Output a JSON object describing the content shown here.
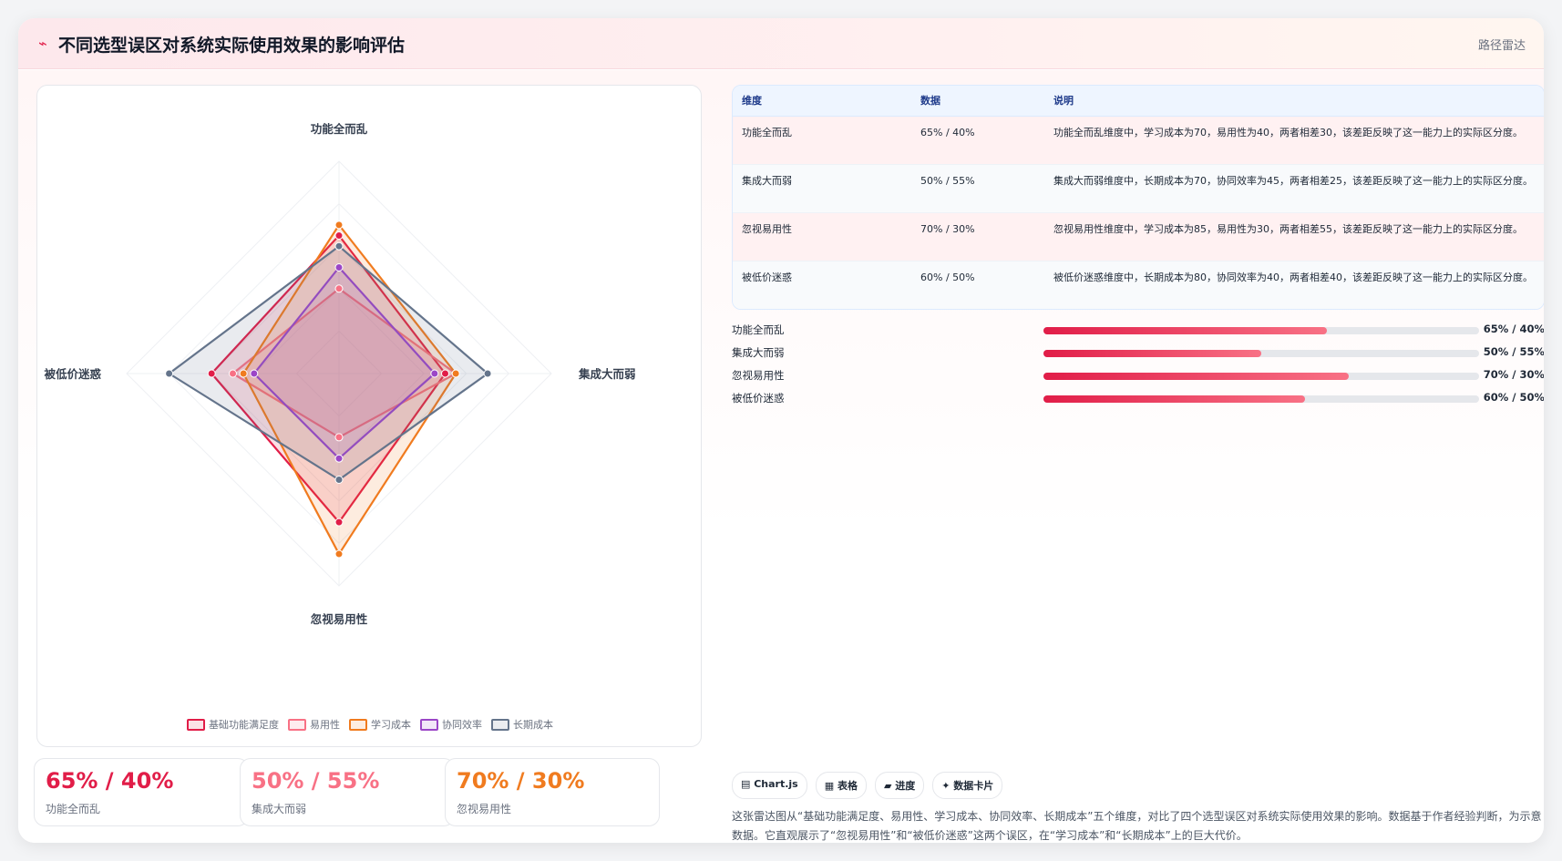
{
  "header": {
    "icon": "sparkline-icon",
    "title": "不同选型误区对系统实际使用效果的影响评估",
    "link": "路径雷达"
  },
  "chart_data": {
    "type": "radar",
    "axes": [
      "功能全而乱",
      "集成大而弱",
      "忽视易用性",
      "被低价迷惑"
    ],
    "range": [
      0,
      100
    ],
    "series": [
      {
        "name": "基础功能满足度",
        "color": "#e11d48",
        "values": [
          65,
          50,
          70,
          60
        ]
      },
      {
        "name": "易用性",
        "color": "#f87185",
        "values": [
          40,
          55,
          30,
          50
        ]
      },
      {
        "name": "学习成本",
        "color": "#f07b1f",
        "values": [
          70,
          55,
          85,
          45
        ]
      },
      {
        "name": "协同效率",
        "color": "#9b46c7",
        "values": [
          50,
          45,
          40,
          40
        ]
      },
      {
        "name": "长期成本",
        "color": "#64748b",
        "values": [
          60,
          70,
          50,
          80
        ]
      }
    ],
    "grid": true,
    "legend": "bottom"
  },
  "stats": [
    {
      "value": "65% / 40%",
      "label": "功能全而乱",
      "color": "#e11d48"
    },
    {
      "value": "50% / 55%",
      "label": "集成大而弱",
      "color": "#f87185"
    },
    {
      "value": "70% / 30%",
      "label": "忽视易用性",
      "color": "#f07b1f"
    }
  ],
  "table": {
    "headers": [
      "维度",
      "数据",
      "说明"
    ],
    "rows": [
      {
        "dim": "功能全而乱",
        "data": "65% / 40%",
        "note": "功能全而乱维度中，学习成本为70，易用性为40，两者相差30，该差距反映了这一能力上的实际区分度。"
      },
      {
        "dim": "集成大而弱",
        "data": "50% / 55%",
        "note": "集成大而弱维度中，长期成本为70，协同效率为45，两者相差25，该差距反映了这一能力上的实际区分度。"
      },
      {
        "dim": "忽视易用性",
        "data": "70% / 30%",
        "note": "忽视易用性维度中，学习成本为85，易用性为30，两者相差55，该差距反映了这一能力上的实际区分度。"
      },
      {
        "dim": "被低价迷惑",
        "data": "60% / 50%",
        "note": "被低价迷惑维度中，长期成本为80，协同效率为40，两者相差40，该差距反映了这一能力上的实际区分度。"
      }
    ]
  },
  "progress": [
    {
      "label": "功能全而乱",
      "value": "65% / 40%",
      "fill": 0.65
    },
    {
      "label": "集成大而弱",
      "value": "50% / 55%",
      "fill": 0.5
    },
    {
      "label": "忽视易用性",
      "value": "70% / 30%",
      "fill": 0.7
    },
    {
      "label": "被低价迷惑",
      "value": "60% / 50%",
      "fill": 0.6
    }
  ],
  "chips": [
    "▤ Chart.js",
    "▦ 表格",
    "▰ 进度",
    "✦ 数据卡片"
  ],
  "description": "这张雷达图从“基础功能满足度、易用性、学习成本、协同效率、长期成本”五个维度，对比了四个选型误区对系统实际使用效果的影响。数据基于作者经验判断，为示意数据。它直观展示了“忽视易用性”和“被低价迷惑”这两个误区，在“学习成本”和“长期成本”上的巨大代价。"
}
